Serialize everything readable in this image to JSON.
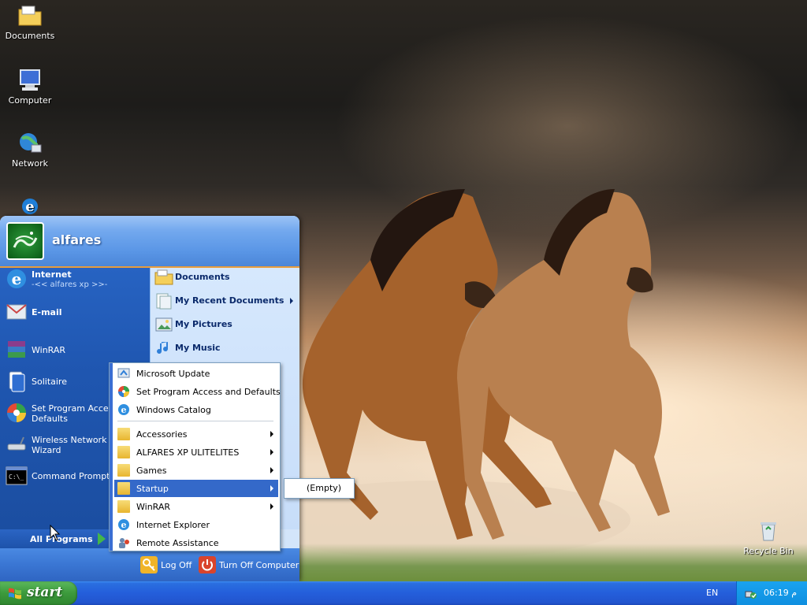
{
  "desktop": {
    "icons": [
      {
        "label": "Documents",
        "icon": "folder-icon"
      },
      {
        "label": "Computer",
        "icon": "computer-icon"
      },
      {
        "label": "Network",
        "icon": "network-icon"
      },
      {
        "label": "",
        "icon": "internet-explorer-icon"
      },
      {
        "label": "Recycle Bin",
        "icon": "recycle-bin-icon"
      }
    ]
  },
  "start_menu": {
    "user": "alfares",
    "left_items": [
      {
        "label": "Internet",
        "sub": "-<< alfares xp >>-",
        "icon": "internet-explorer-icon"
      },
      {
        "label": "E-mail",
        "icon": "email-icon"
      },
      {
        "label": "WinRAR",
        "icon": "winrar-icon"
      },
      {
        "label": "Solitaire",
        "icon": "solitaire-icon"
      },
      {
        "label": "Set Program Access and",
        "label2": "Defaults",
        "icon": "program-access-icon"
      },
      {
        "label": "Wireless Network Se",
        "label2": "Wizard",
        "icon": "wireless-network-icon"
      },
      {
        "label": "Command Prompt",
        "icon": "command-prompt-icon"
      }
    ],
    "all_programs": "All Programs",
    "right_items": [
      {
        "label": "Documents",
        "icon": "documents-folder-icon"
      },
      {
        "label": "My Recent Documents",
        "icon": "recent-documents-icon"
      },
      {
        "label": "My Pictures",
        "icon": "pictures-icon"
      },
      {
        "label": "My Music",
        "icon": "music-icon"
      }
    ],
    "footer": {
      "log_off": "Log Off",
      "turn_off": "Turn Off Computer"
    }
  },
  "programs_menu": {
    "items": [
      {
        "label": "Microsoft Update",
        "icon": "windows-update-icon"
      },
      {
        "label": "Set Program Access and Defaults",
        "icon": "program-access-icon"
      },
      {
        "label": "Windows Catalog",
        "icon": "windows-catalog-icon"
      },
      {
        "label": "Accessories",
        "icon": "folder-icon",
        "submenu": true
      },
      {
        "label": "ALFARES XP ULITELITES",
        "icon": "folder-icon",
        "submenu": true
      },
      {
        "label": "Games",
        "icon": "folder-icon",
        "submenu": true
      },
      {
        "label": "Startup",
        "icon": "folder-icon",
        "submenu": true,
        "active": true
      },
      {
        "label": "WinRAR",
        "icon": "folder-icon",
        "submenu": true
      },
      {
        "label": "Internet Explorer",
        "icon": "internet-explorer-icon"
      },
      {
        "label": "Remote Assistance",
        "icon": "remote-assistance-icon"
      }
    ],
    "startup_submenu": "(Empty)"
  },
  "taskbar": {
    "start_label": "start",
    "language": "EN",
    "clock": "06:19 م"
  },
  "colors": {
    "taskbar_blue": "#245edb",
    "start_green": "#3c9a3c",
    "menu_highlight": "#3469c9",
    "logoff_orange": "#e89d3d"
  }
}
